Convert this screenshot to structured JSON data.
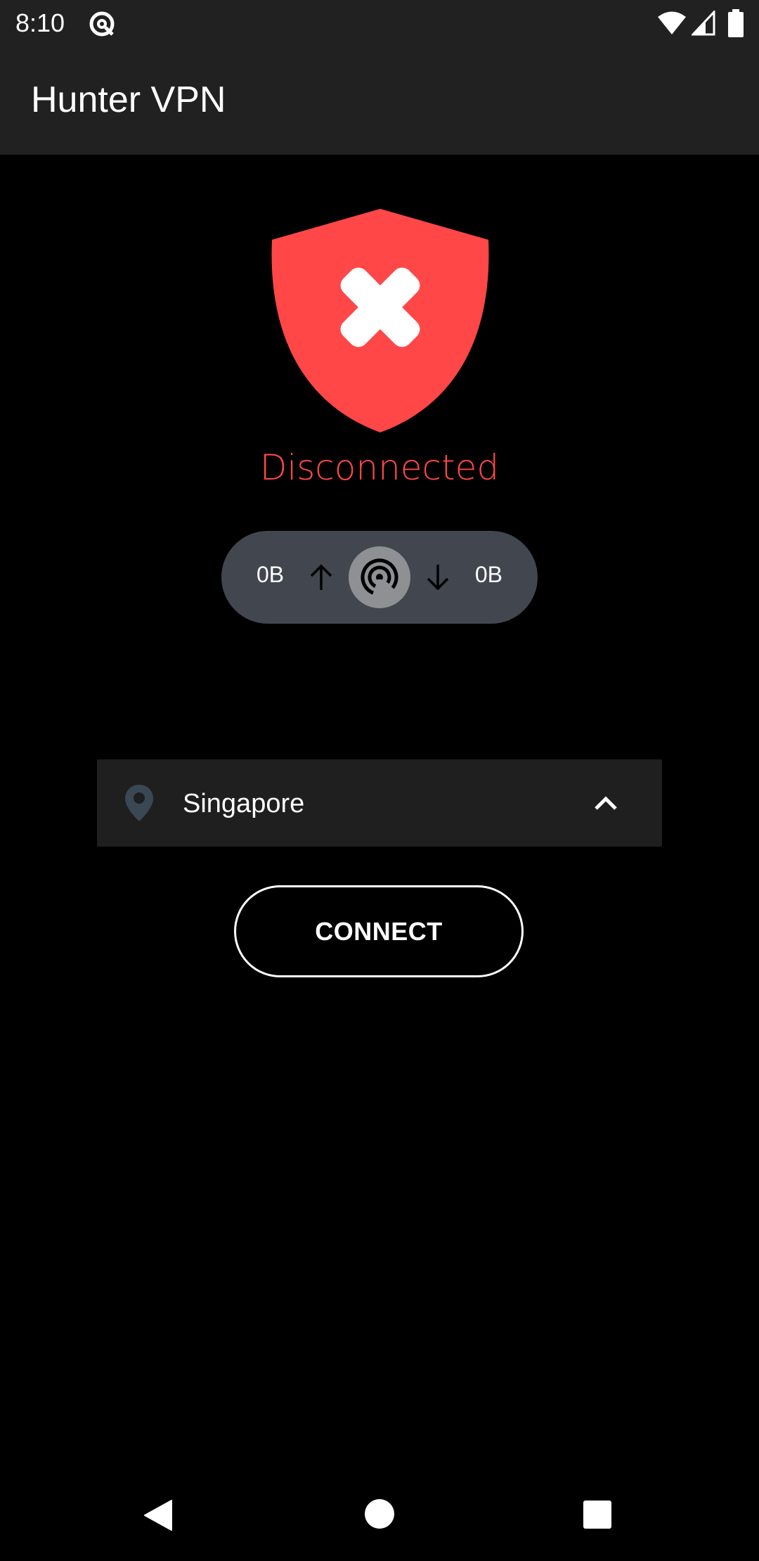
{
  "status_bar": {
    "time": "8:10",
    "app_icon": "at-sign-circle-icon",
    "wifi_icon": "wifi-icon",
    "signal_icon": "cell-signal-icon",
    "battery_icon": "battery-icon"
  },
  "app_bar": {
    "title": "Hunter VPN"
  },
  "status": {
    "icon": "shield-x-icon",
    "text": "Disconnected",
    "color": "#ff4747"
  },
  "traffic": {
    "upload_value": "0B",
    "download_value": "0B",
    "upload_icon": "arrow-up-icon",
    "download_icon": "arrow-down-icon",
    "center_icon": "signal-broadcast-icon",
    "pill_color": "#41464f"
  },
  "location": {
    "icon": "location-pin-icon",
    "label": "Singapore",
    "toggle_icon": "chevron-up-icon"
  },
  "connect_button": {
    "label": "CONNECT"
  },
  "nav_bar": {
    "back_icon": "back-triangle-icon",
    "home_icon": "home-circle-icon",
    "recents_icon": "recents-square-icon"
  }
}
